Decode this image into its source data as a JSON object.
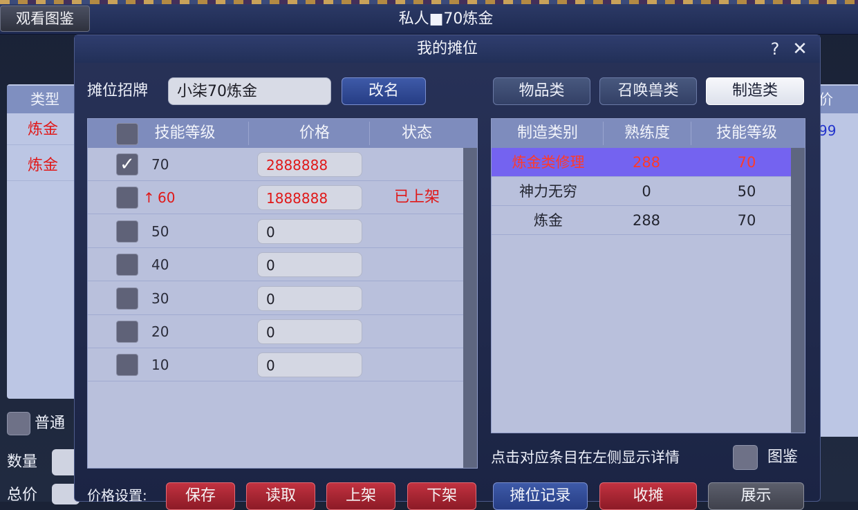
{
  "top_bar": {
    "view_atlas_label": "观看图鉴",
    "chat_title": "私人■70炼金"
  },
  "background_window": {
    "type_header": "类型",
    "rows": [
      "炼金",
      "炼金"
    ],
    "normal_label": "普通",
    "quantity_label": "数量",
    "total_label": "总价",
    "right_header": "价",
    "right_value": "99"
  },
  "dialog": {
    "title": "我的摊位",
    "help_label": "?",
    "close_label": "✕",
    "sign_label": "摊位招牌",
    "sign_value": "小柒70炼金",
    "rename_label": "改名",
    "tabs": [
      "物品类",
      "召唤兽类",
      "制造类"
    ],
    "active_tab": "制造类"
  },
  "skill_table": {
    "headers": [
      "技能等级",
      "价格",
      "状态"
    ],
    "rows": [
      {
        "checked": true,
        "up_arrow": false,
        "level": "70",
        "price": "2888888",
        "status": "",
        "highlight": true
      },
      {
        "checked": false,
        "up_arrow": true,
        "level": "60",
        "price": "1888888",
        "status": "已上架",
        "highlight": true
      },
      {
        "checked": false,
        "up_arrow": false,
        "level": "50",
        "price": "0",
        "status": "",
        "highlight": false
      },
      {
        "checked": false,
        "up_arrow": false,
        "level": "40",
        "price": "0",
        "status": "",
        "highlight": false
      },
      {
        "checked": false,
        "up_arrow": false,
        "level": "30",
        "price": "0",
        "status": "",
        "highlight": false
      },
      {
        "checked": false,
        "up_arrow": false,
        "level": "20",
        "price": "0",
        "status": "",
        "highlight": false
      },
      {
        "checked": false,
        "up_arrow": false,
        "level": "10",
        "price": "0",
        "status": "",
        "highlight": false
      }
    ],
    "checkmark": "✓",
    "arrow": "↑"
  },
  "craft_table": {
    "headers": [
      "制造类别",
      "熟练度",
      "技能等级"
    ],
    "rows": [
      {
        "category": "炼金类修理",
        "proficiency": "288",
        "level": "70",
        "selected": true
      },
      {
        "category": "神力无穷",
        "proficiency": "0",
        "level": "50",
        "selected": false
      },
      {
        "category": "炼金",
        "proficiency": "288",
        "level": "70",
        "selected": false
      }
    ]
  },
  "hint": {
    "text": "点击对应条目在左侧显示详情",
    "atlas_label": "图鉴"
  },
  "bottom": {
    "price_setting_label": "价格设置:",
    "save_label": "保存",
    "load_label": "读取",
    "list_label": "上架",
    "delist_label": "下架",
    "stall_log_label": "摊位记录",
    "close_stall_label": "收摊",
    "show_label": "展示"
  },
  "colors": {
    "accent_red": "#e01818",
    "selected_row": "#7463f0",
    "table_bg": "#b9c0dc",
    "header_bg": "#7e8cbd"
  }
}
